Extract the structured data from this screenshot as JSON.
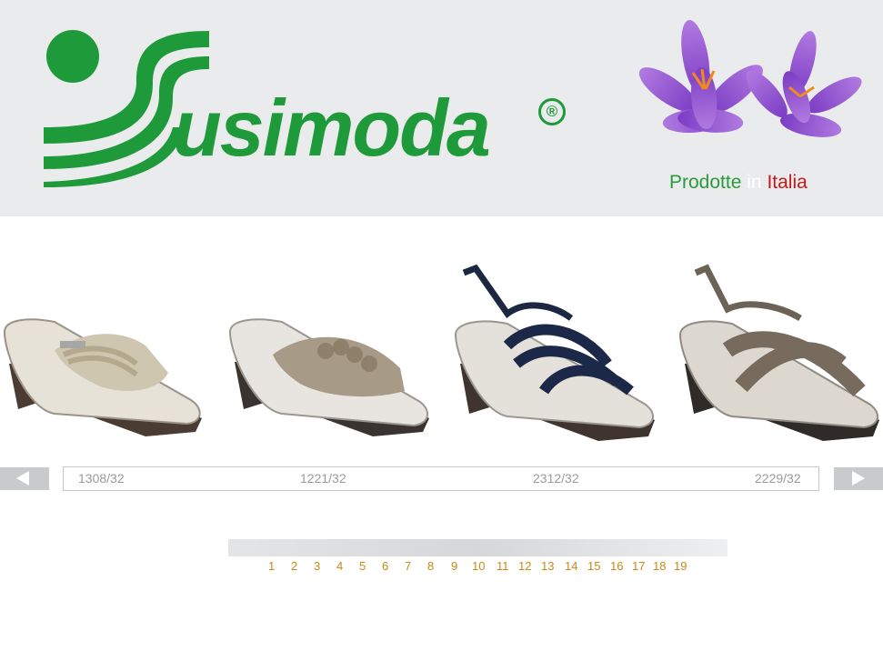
{
  "brand": {
    "name": "usimoda",
    "registered_mark": "®",
    "color": "#1f9a3a"
  },
  "tagline": {
    "word1": "Prodotte",
    "word2": "in",
    "word3": "Italia",
    "colors": [
      "#2a9a3a",
      "#ffffff",
      "#c51a1a"
    ]
  },
  "carousel": {
    "prev_icon": "triangle-left-icon",
    "next_icon": "triangle-right-icon",
    "products": [
      {
        "code": "1308/32",
        "image": "beige wedge slide sandal"
      },
      {
        "code": "1221/32",
        "image": "taupe wedge slide with flowers"
      },
      {
        "code": "2312/32",
        "image": "navy slingback wedge sandal"
      },
      {
        "code": "2229/32",
        "image": "bronze slingback wedge sandal"
      }
    ]
  },
  "pagination": {
    "pages": [
      "1",
      "2",
      "3",
      "4",
      "5",
      "6",
      "7",
      "8",
      "9",
      "10",
      "11",
      "12",
      "13",
      "14",
      "15",
      "16",
      "17",
      "18",
      "19"
    ],
    "color": "#c78a12"
  }
}
